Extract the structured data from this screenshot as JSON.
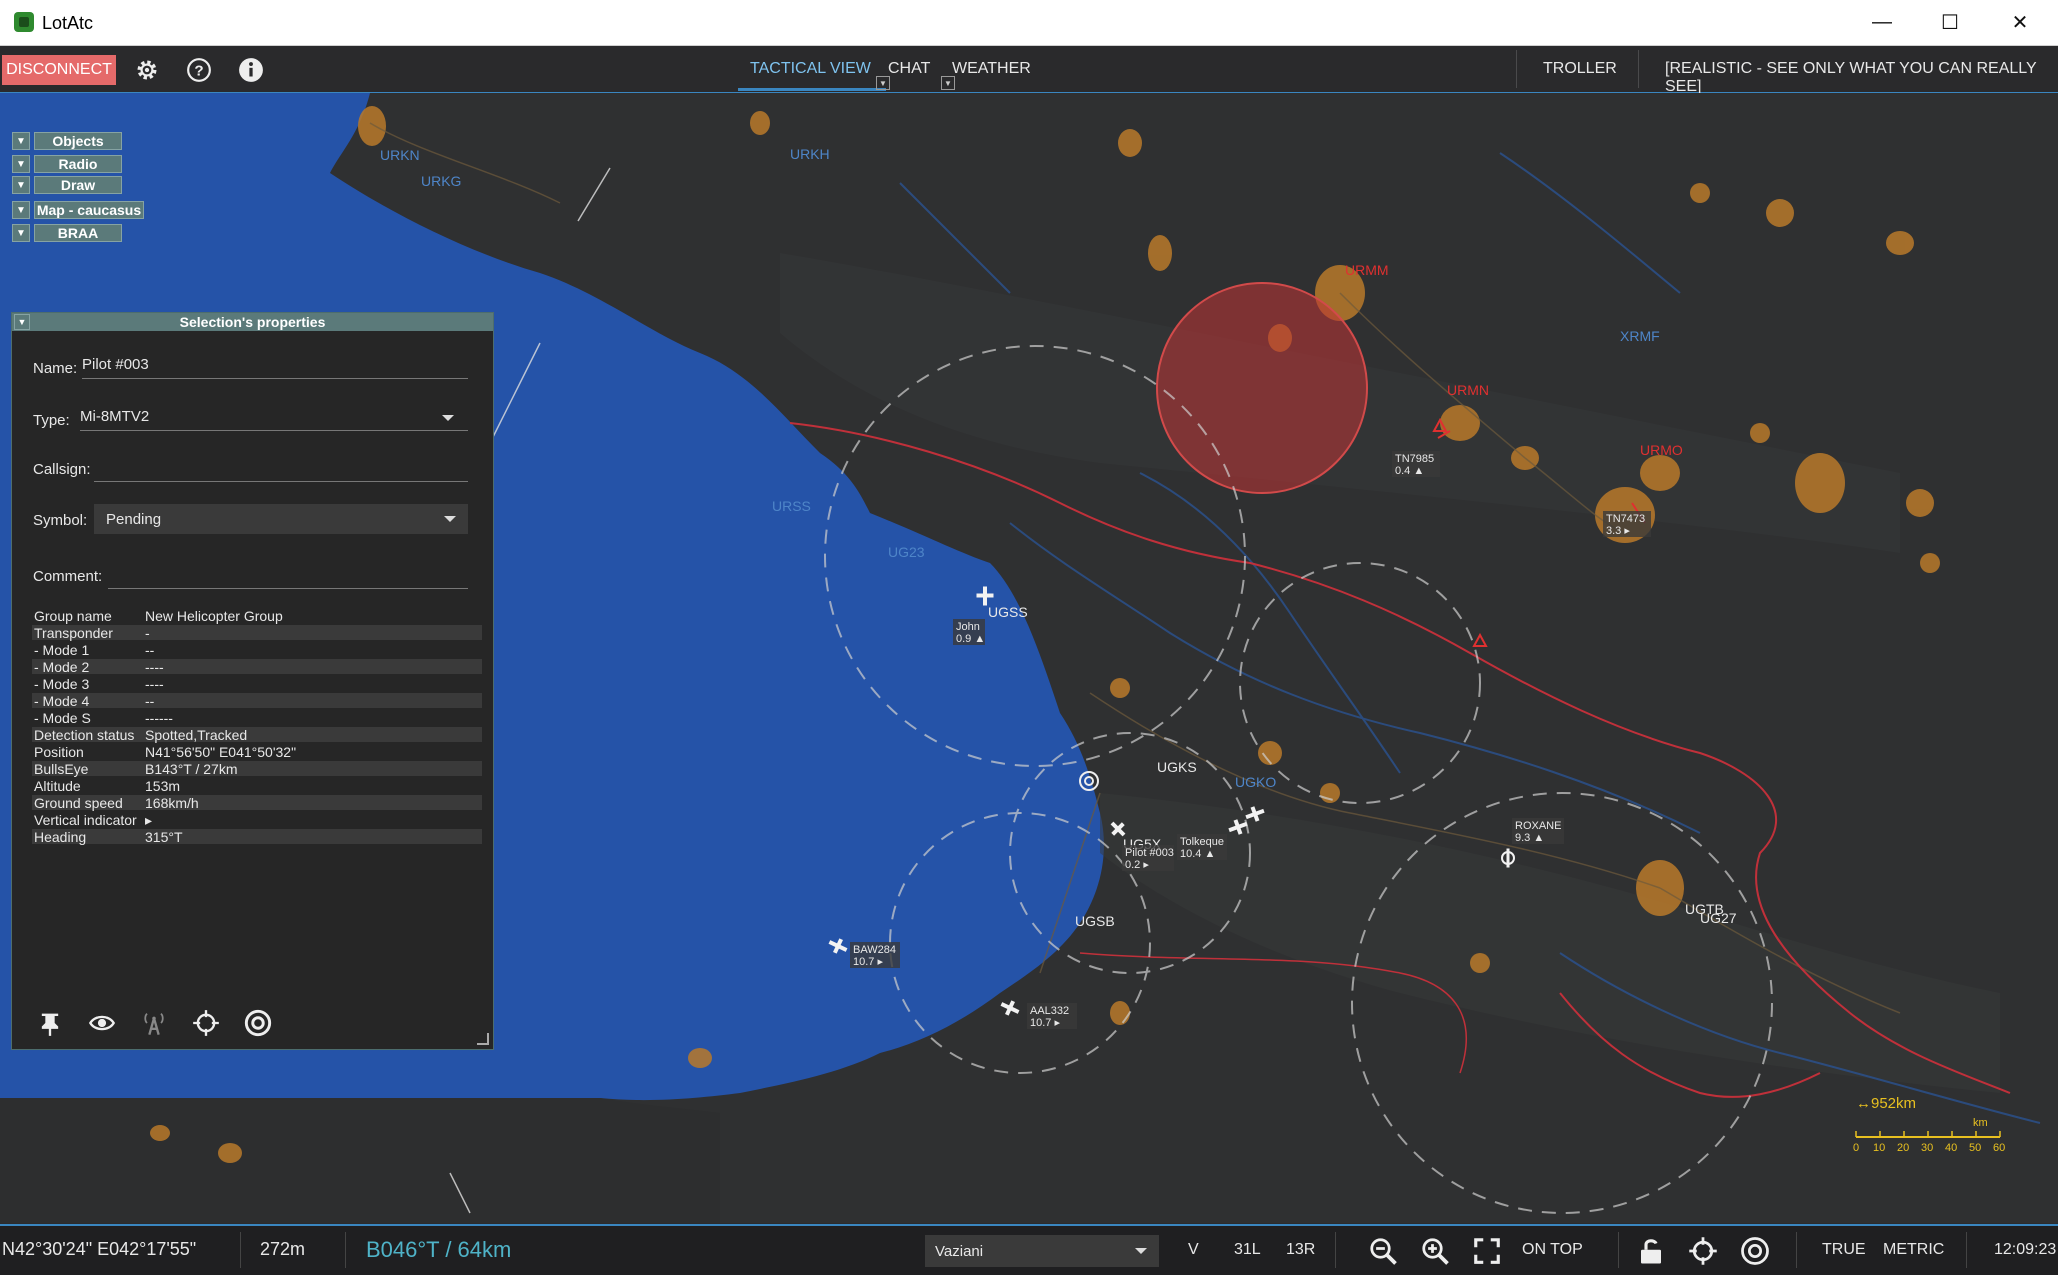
{
  "window": {
    "title": "LotAtc"
  },
  "toolbar": {
    "disconnect_label": "DISCONNECT",
    "tabs": [
      {
        "label": "TACTICAL VIEW",
        "active": true
      },
      {
        "label": "CHAT",
        "active": false
      },
      {
        "label": "WEATHER",
        "active": false
      }
    ],
    "role_label": "TROLLER",
    "mode_label": "[REALISTIC - SEE ONLY WHAT YOU CAN REALLY SEE]"
  },
  "side_panels": [
    {
      "label": "Objects"
    },
    {
      "label": "Radio"
    },
    {
      "label": "Draw"
    },
    {
      "label": "Map - caucasus"
    },
    {
      "label": "BRAA"
    }
  ],
  "properties": {
    "header": "Selection's properties",
    "name_label": "Name:",
    "name_value": "Pilot #003",
    "type_label": "Type:",
    "type_value": "Mi-8MTV2",
    "callsign_label": "Callsign:",
    "callsign_value": "",
    "symbol_label": "Symbol:",
    "symbol_value": "Pending",
    "comment_label": "Comment:",
    "comment_value": "",
    "rows": [
      {
        "key": "Group name",
        "value": "New Helicopter Group"
      },
      {
        "key": "Transponder",
        "value": "-"
      },
      {
        "key": " - Mode 1",
        "value": "--"
      },
      {
        "key": " - Mode 2",
        "value": "----"
      },
      {
        "key": " - Mode 3",
        "value": "----"
      },
      {
        "key": " - Mode 4",
        "value": "--"
      },
      {
        "key": " - Mode S",
        "value": "------"
      },
      {
        "key": "Detection status",
        "value": "Spotted,Tracked"
      },
      {
        "key": "Position",
        "value": "N41°56'50\" E041°50'32\""
      },
      {
        "key": "BullsEye",
        "value": "B143°T / 27km"
      },
      {
        "key": "Altitude",
        "value": "153m"
      },
      {
        "key": "Ground speed",
        "value": "168km/h"
      },
      {
        "key": "Vertical indicator",
        "value": "▸"
      },
      {
        "key": "Heading",
        "value": "315°T"
      }
    ]
  },
  "map": {
    "airfields": [
      "URKN",
      "URKG",
      "URKH",
      "URMM",
      "XRMF",
      "URMN",
      "URMO",
      "URSS",
      "UG23",
      "UGSS",
      "UGKS",
      "UGKO",
      "UG5X",
      "UGSB",
      "UGTB",
      "UG27"
    ],
    "contacts": [
      {
        "label": "John",
        "sub": "0.9 ▲"
      },
      {
        "label": "Pilot #003",
        "sub": "0.2 ▸"
      },
      {
        "label": "Tolkeque",
        "sub": "10.4 ▲"
      },
      {
        "label": "ROXANE",
        "sub": "9.3 ▲"
      },
      {
        "label": "BAW284",
        "sub": "10.7 ▸"
      },
      {
        "label": "AAL332",
        "sub": "10.7 ▸"
      },
      {
        "label": "TN7985",
        "sub": "0.4 ▲"
      },
      {
        "label": "TN7473",
        "sub": "3.3 ▸"
      }
    ],
    "scale": {
      "range_label": "↔952km",
      "unit": "km",
      "ticks": [
        "0",
        "10",
        "20",
        "30",
        "40",
        "50",
        "60"
      ]
    },
    "colors": {
      "sea": "#2553a8",
      "land": "#2f3031",
      "urban": "#b8792a",
      "border": "#c0303a",
      "threat": "#c03535"
    }
  },
  "statusbar": {
    "cursor_position": "N42°30'24\" E042°17'55\"",
    "cursor_elevation": "272m",
    "bullseye": "B046°T / 64km",
    "airport": "Vaziani",
    "runway_v": "V",
    "runway_1": "31L",
    "runway_2": "13R",
    "on_top_label": "ON TOP",
    "true_label": "TRUE",
    "metric_label": "METRIC",
    "time": "12:09:23"
  }
}
